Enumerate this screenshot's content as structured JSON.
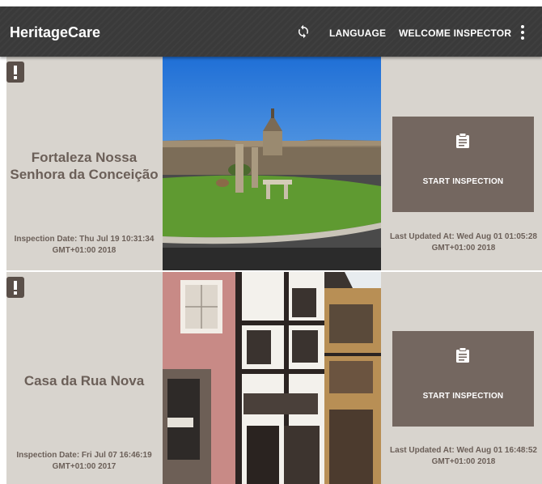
{
  "appbar": {
    "title": "HeritageCare",
    "language_label": "LANGUAGE",
    "welcome_label": "WELCOME INSPECTOR",
    "sync_icon": "sync-icon",
    "more_icon": "more-vert-icon"
  },
  "colors": {
    "appbar_bg": "#3a3a3a",
    "card_bg": "#d8d4ce",
    "text": "#6b5f58",
    "button_bg": "#746760",
    "alert_badge": "#5a4f49"
  },
  "cards": [
    {
      "name": "Fortaleza Nossa Senhora da Conceição",
      "inspection_date": "Inspection Date: Thu Jul 19 10:31:34 GMT+01:00 2018",
      "button_label": "START INSPECTION",
      "last_updated": "Last Updated At: Wed Aug 01 01:05:28 GMT+01:00 2018",
      "alert_icon": "alert-icon",
      "button_icon": "clipboard-icon"
    },
    {
      "name": "Casa da Rua Nova",
      "inspection_date": "Inspection Date: Fri Jul 07 16:46:19 GMT+01:00 2017",
      "button_label": "START INSPECTION",
      "last_updated": "Last Updated At: Wed Aug 01 16:48:52 GMT+01:00 2018",
      "alert_icon": "alert-icon",
      "button_icon": "clipboard-icon"
    }
  ]
}
